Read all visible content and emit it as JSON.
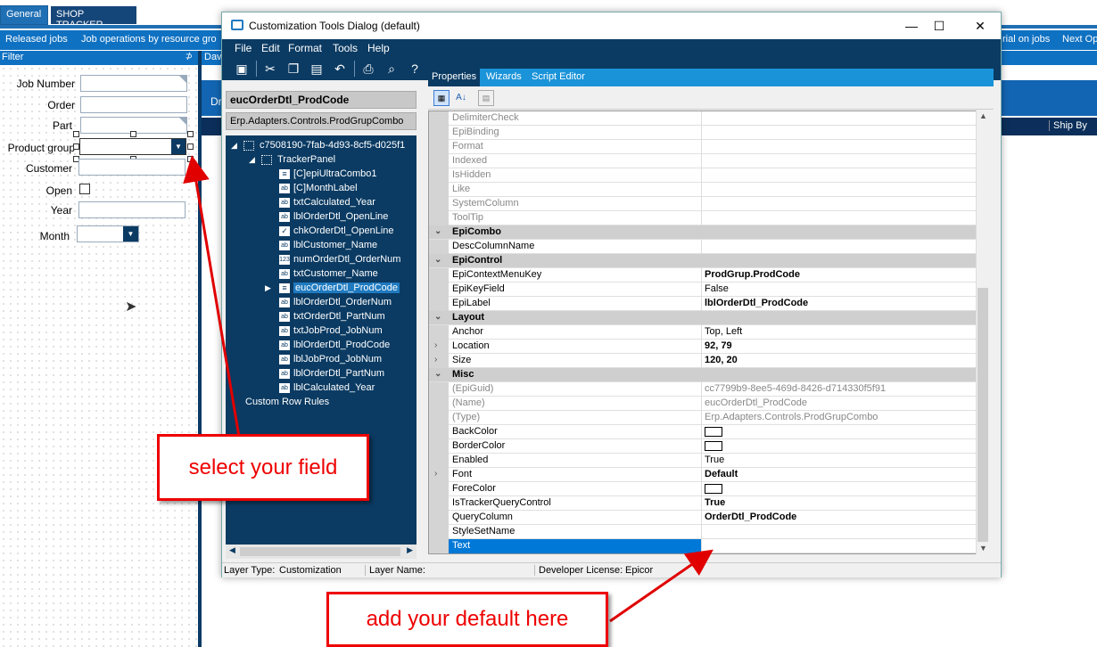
{
  "background": {
    "tabs": [
      "General",
      "SHOP TRACKER"
    ],
    "nav_items": [
      "Released jobs",
      "Job operations by resource gro",
      "rial on jobs",
      "Next Op"
    ],
    "right_partial": [
      "Dav",
      "Dr"
    ],
    "ship_by": "Ship By",
    "filter_title": "Filter",
    "filter_pin": "⊅",
    "fields": [
      {
        "label": "Job Number"
      },
      {
        "label": "Order"
      },
      {
        "label": "Part"
      },
      {
        "label": "Product group"
      },
      {
        "label": "Customer"
      },
      {
        "label": "Open"
      },
      {
        "label": "Year"
      },
      {
        "label": "Month"
      }
    ]
  },
  "dialog": {
    "title": "Customization Tools Dialog (default)",
    "window_buttons": [
      "—",
      "☐",
      "✕"
    ],
    "menu": [
      "File",
      "Edit",
      "Format",
      "Tools",
      "Help"
    ],
    "selected_control": "eucOrderDtl_ProdCode",
    "selected_type": "Erp.Adapters.Controls.ProdGrupCombo",
    "tree": {
      "root": "c7508190-7fab-4d93-8cf5-d025f1",
      "panel": "TrackerPanel",
      "children": [
        {
          "label": "[C]epiUltraCombo1",
          "icon": "combo-icon"
        },
        {
          "label": "[C]MonthLabel",
          "icon": "ab"
        },
        {
          "label": "txtCalculated_Year",
          "icon": "ab"
        },
        {
          "label": "lblOrderDtl_OpenLine",
          "icon": "ab"
        },
        {
          "label": "chkOrderDtl_OpenLine",
          "icon": "checkbox-icon"
        },
        {
          "label": "lblCustomer_Name",
          "icon": "ab"
        },
        {
          "label": "numOrderDtl_OrderNum",
          "icon": "123"
        },
        {
          "label": "txtCustomer_Name",
          "icon": "ab"
        },
        {
          "label": "eucOrderDtl_ProdCode",
          "icon": "combo-icon",
          "selected": true
        },
        {
          "label": "lblOrderDtl_OrderNum",
          "icon": "ab"
        },
        {
          "label": "txtOrderDtl_PartNum",
          "icon": "ab"
        },
        {
          "label": "txtJobProd_JobNum",
          "icon": "ab"
        },
        {
          "label": "lblOrderDtl_ProdCode",
          "icon": "ab"
        },
        {
          "label": "lblJobProd_JobNum",
          "icon": "ab"
        },
        {
          "label": "lblOrderDtl_PartNum",
          "icon": "ab"
        },
        {
          "label": "lblCalculated_Year",
          "icon": "ab"
        }
      ],
      "footer": "Custom Row Rules"
    },
    "panel_tabs": [
      "Properties",
      "Wizards",
      "Script Editor"
    ],
    "properties": [
      {
        "name": "DelimiterCheck",
        "value": "",
        "dim": true
      },
      {
        "name": "EpiBinding",
        "value": "",
        "dim": true
      },
      {
        "name": "Format",
        "value": "",
        "dim": true
      },
      {
        "name": "Indexed",
        "value": "",
        "dim": true
      },
      {
        "name": "IsHidden",
        "value": "",
        "dim": true
      },
      {
        "name": "Like",
        "value": "",
        "dim": true
      },
      {
        "name": "SystemColumn",
        "value": "",
        "dim": true
      },
      {
        "name": "ToolTip",
        "value": "",
        "dim": true
      },
      {
        "category": "EpiCombo"
      },
      {
        "name": "DescColumnName",
        "value": ""
      },
      {
        "category": "EpiControl"
      },
      {
        "name": "EpiContextMenuKey",
        "value": "ProdGrup.ProdCode",
        "bold": true
      },
      {
        "name": "EpiKeyField",
        "value": "False"
      },
      {
        "name": "EpiLabel",
        "value": "lblOrderDtl_ProdCode",
        "bold": true
      },
      {
        "category": "Layout"
      },
      {
        "name": "Anchor",
        "value": "Top, Left"
      },
      {
        "name": "Location",
        "value": "92, 79",
        "bold": true,
        "expandable": true
      },
      {
        "name": "Size",
        "value": "120, 20",
        "bold": true,
        "expandable": true
      },
      {
        "category": "Misc"
      },
      {
        "name": "(EpiGuid)",
        "value": "cc7799b9-8ee5-469d-8426-d714330f5f91",
        "dim": true
      },
      {
        "name": "(Name)",
        "value": "eucOrderDtl_ProdCode",
        "dim": true
      },
      {
        "name": "(Type)",
        "value": "Erp.Adapters.Controls.ProdGrupCombo",
        "dim": true
      },
      {
        "name": "BackColor",
        "value": "",
        "swatch": true
      },
      {
        "name": "BorderColor",
        "value": "",
        "swatch": true
      },
      {
        "name": "Enabled",
        "value": "True"
      },
      {
        "name": "Font",
        "value": "Default",
        "bold": true,
        "expandable": true
      },
      {
        "name": "ForeColor",
        "value": "",
        "swatch": true
      },
      {
        "name": "IsTrackerQueryControl",
        "value": "True",
        "bold": true
      },
      {
        "name": "QueryColumn",
        "value": "OrderDtl_ProdCode",
        "bold": true
      },
      {
        "name": "StyleSetName",
        "value": ""
      },
      {
        "name": "Text",
        "value": "",
        "selected": true
      }
    ],
    "status": {
      "layer_type_label": "Layer Type:",
      "layer_type": "Customization",
      "layer_name_label": "Layer Name:",
      "layer_name": "",
      "license_label": "Developer License:",
      "license": "Epicor"
    }
  },
  "annotations": {
    "select_field": "select your field",
    "add_default": "add your default here",
    "color": "#e00000"
  }
}
